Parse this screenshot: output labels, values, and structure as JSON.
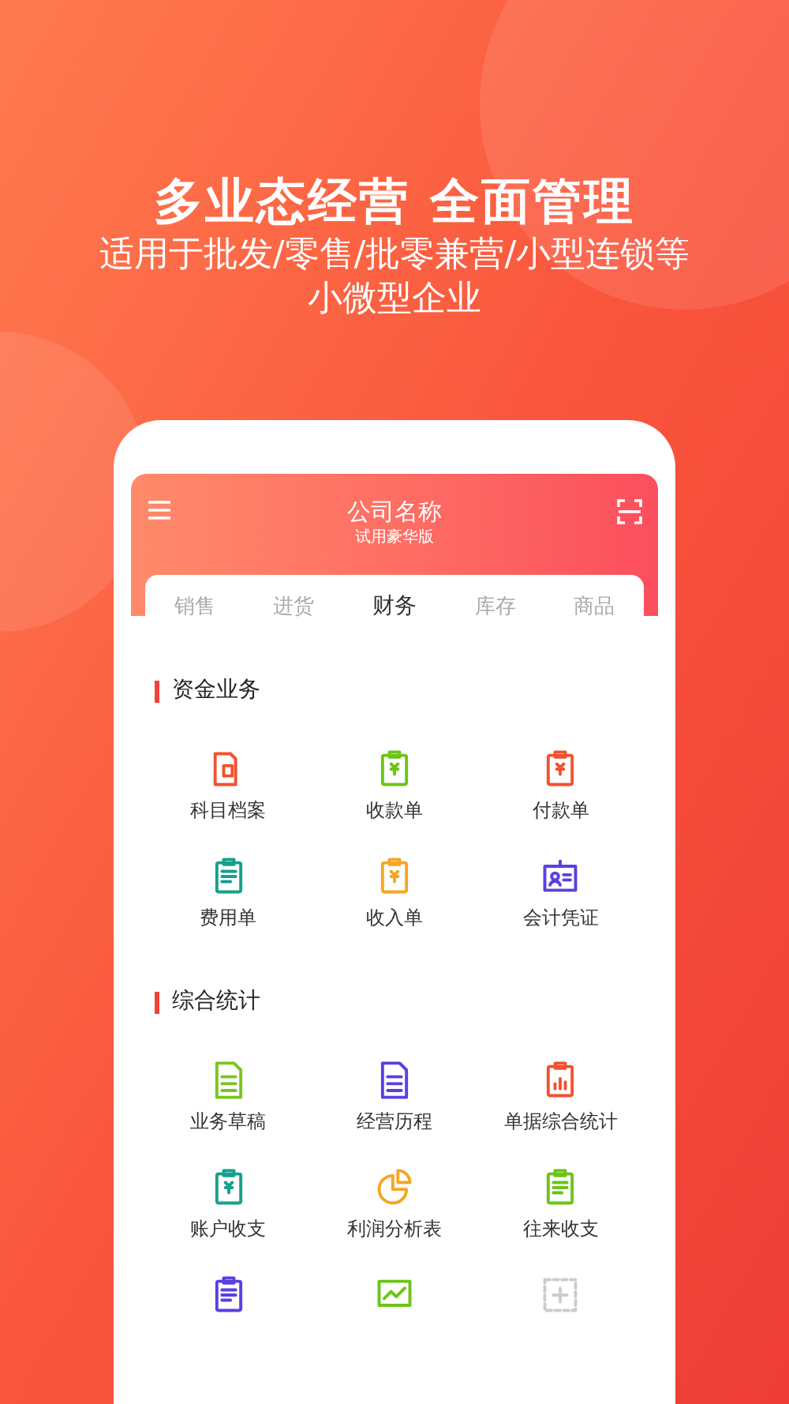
{
  "headline": "多业态经营 全面管理",
  "subtitle_lines": [
    "适用于批发/零售/批零兼营/小型连锁等",
    "小微型企业"
  ],
  "app": {
    "title": "公司名称",
    "subtitle": "试用豪华版",
    "tabs": [
      {
        "label": "销售",
        "selected": false
      },
      {
        "label": "进货",
        "selected": false
      },
      {
        "label": "财务",
        "selected": true
      },
      {
        "label": "库存",
        "selected": false
      },
      {
        "label": "商品",
        "selected": false
      }
    ],
    "sections": [
      {
        "title": "资金业务",
        "items": [
          {
            "label": "科目档案",
            "kind": "folder",
            "color": "#f2522e"
          },
          {
            "label": "收款单",
            "kind": "receive",
            "color": "#6cc417"
          },
          {
            "label": "付款单",
            "kind": "pay",
            "color": "#f2522e"
          },
          {
            "label": "费用单",
            "kind": "list",
            "color": "#17a08a"
          },
          {
            "label": "收入单",
            "kind": "clip",
            "color": "#f5a623"
          },
          {
            "label": "会计凭证",
            "kind": "card",
            "color": "#5b3fe0"
          }
        ]
      },
      {
        "title": "综合统计",
        "items": [
          {
            "label": "业务草稿",
            "kind": "doc",
            "color": "#7cc41f"
          },
          {
            "label": "经营历程",
            "kind": "doc",
            "color": "#5b3fe0"
          },
          {
            "label": "单据综合统计",
            "kind": "bars",
            "color": "#f2522e"
          },
          {
            "label": "账户收支",
            "kind": "clip",
            "color": "#17a08a"
          },
          {
            "label": "利润分析表",
            "kind": "pie",
            "color": "#f5a623"
          },
          {
            "label": "往来收支",
            "kind": "list",
            "color": "#6cc417"
          },
          {
            "kind": "list",
            "color": "#5b3fe0"
          },
          {
            "kind": "trend",
            "color": "#6cc417"
          },
          {
            "kind": "add",
            "color": "#cccccc"
          }
        ]
      }
    ]
  }
}
